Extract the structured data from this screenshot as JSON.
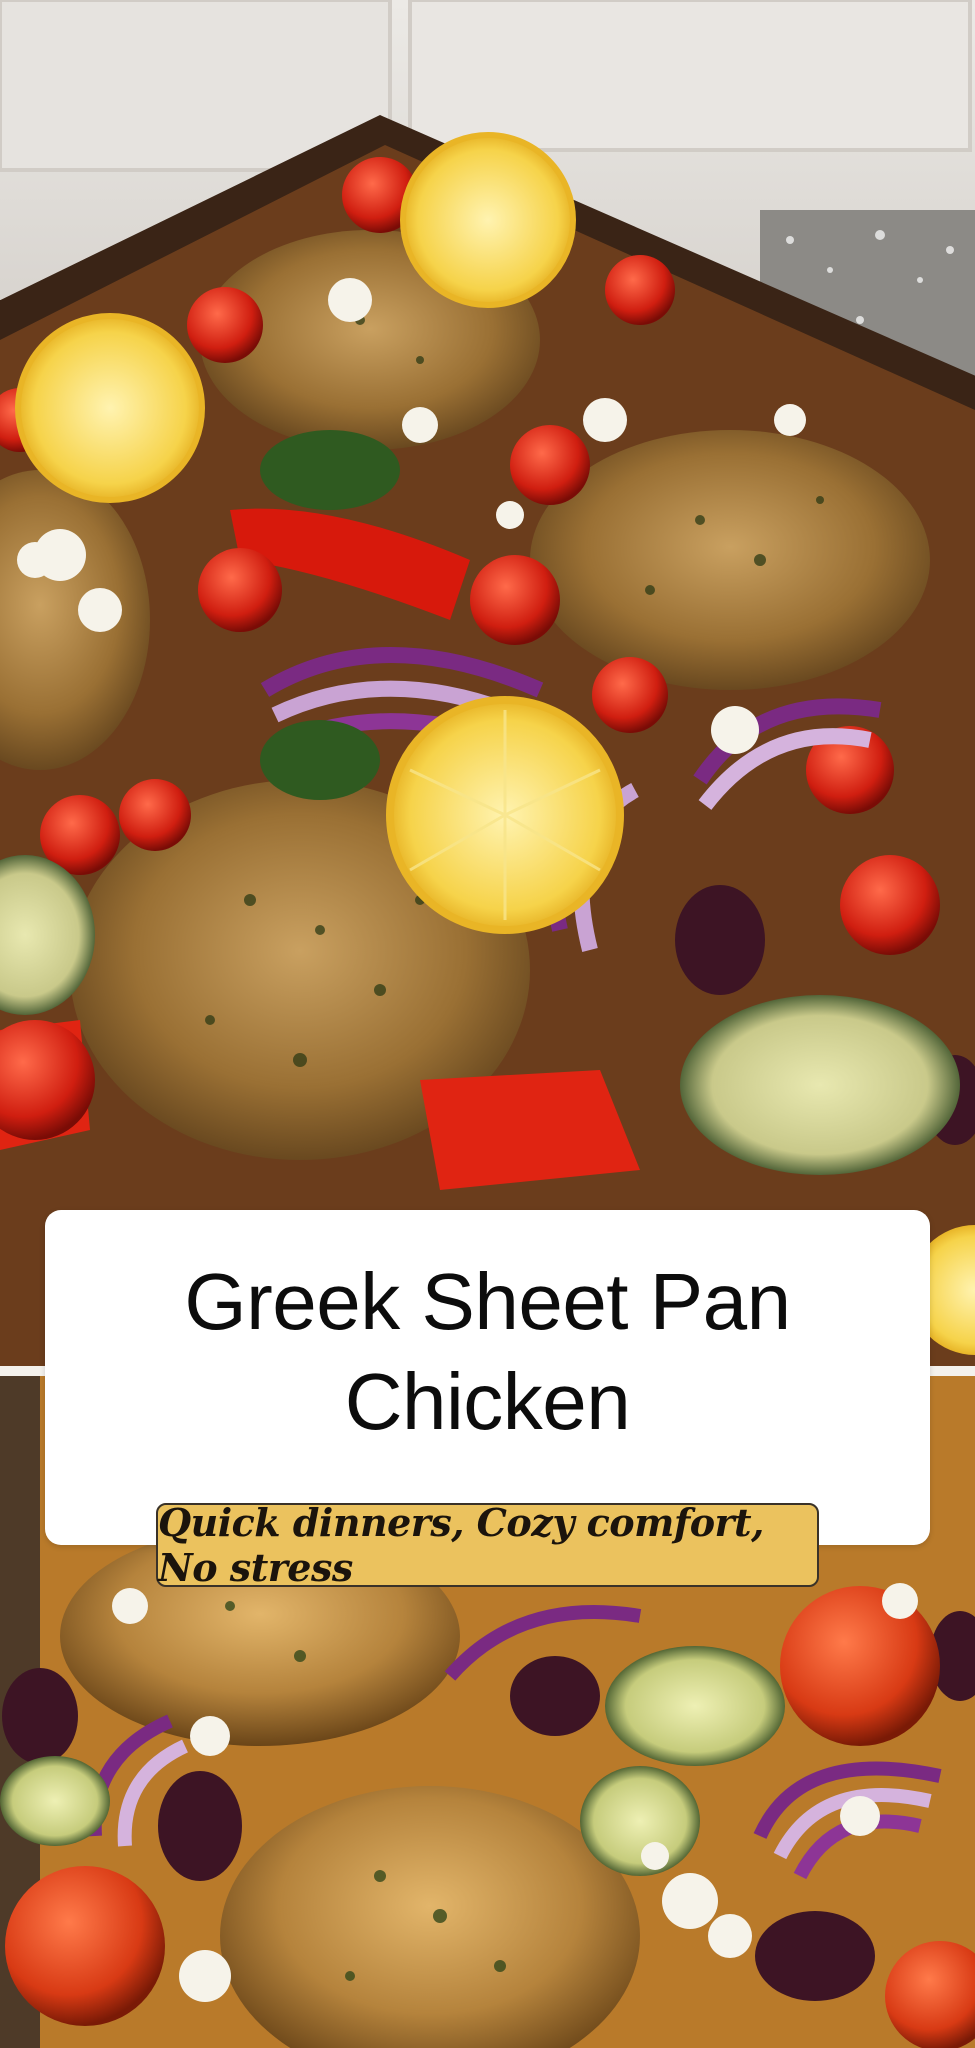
{
  "title": "Greek Sheet Pan Chicken",
  "tagline": "Quick dinners, Cozy comfort, No stress",
  "colors": {
    "card_background": "#ffffff",
    "tagline_background": "#ebc25e",
    "title_text": "#0c0c0c",
    "tagline_text": "#1b140c"
  },
  "images": [
    {
      "name": "top-food-photo",
      "depicts": [
        "roasted chicken thighs",
        "lemon slices",
        "cherry tomatoes",
        "red bell peppers",
        "red onion",
        "zucchini",
        "feta",
        "kalamata olives",
        "sheet pan"
      ]
    },
    {
      "name": "bottom-food-photo",
      "depicts": [
        "roasted chicken thighs",
        "red onion",
        "zucchini",
        "cherry tomatoes",
        "feta",
        "kalamata olives"
      ]
    }
  ]
}
